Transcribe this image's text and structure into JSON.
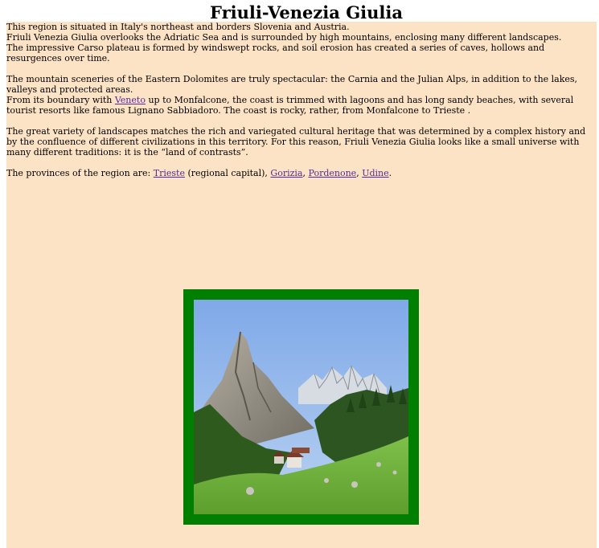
{
  "title": "Friuli-Venezia Giulia",
  "paragraphs": {
    "p1_line1": "This region is situated in Italy's northeast and borders Slovenia and Austria.",
    "p1_line2": "Friuli Venezia Giulia overlooks the Adriatic Sea and is surrounded by high mountains, enclosing many different landscapes.",
    "p1_line3": "The impressive Carso plateau is formed by windswept rocks, and soil erosion has created a series of caves, hollows and resurgences over time.",
    "p2_line1": "The mountain sceneries of the Eastern Dolomites are truly spectacular: the Carnia and the Julian Alps, in addition to the lakes, valleys and protected areas.",
    "p2_line2_before": "From its boundary with ",
    "p2_line2_link": "Veneto",
    "p2_line2_after": " up to Monfalcone, the coast is trimmed with lagoons and has long sandy beaches, with several tourist resorts like famous Lignano Sabbiadoro. The coast is rocky, rather, from Monfalcone to Trieste .",
    "p3": "The great variety of landscapes matches the rich and variegated cultural heritage that was determined by a complex history and by the confluence of different civilizations in this territory. For this reason, Friuli Venezia Giulia looks like a small universe with many different traditions: it is the “land of contrasts”.",
    "p4_before": "The provinces of the region are: ",
    "p4_sep1": " (regional capital), ",
    "p4_sep2": ", ",
    "p4_sep3": ", ",
    "p4_end": "."
  },
  "provinces": [
    "Trieste",
    "Gorizia",
    "Pordenone",
    "Udine"
  ],
  "colors": {
    "panel_background": "#fde3c6",
    "frame": "#007f00",
    "link": "#55299a"
  }
}
